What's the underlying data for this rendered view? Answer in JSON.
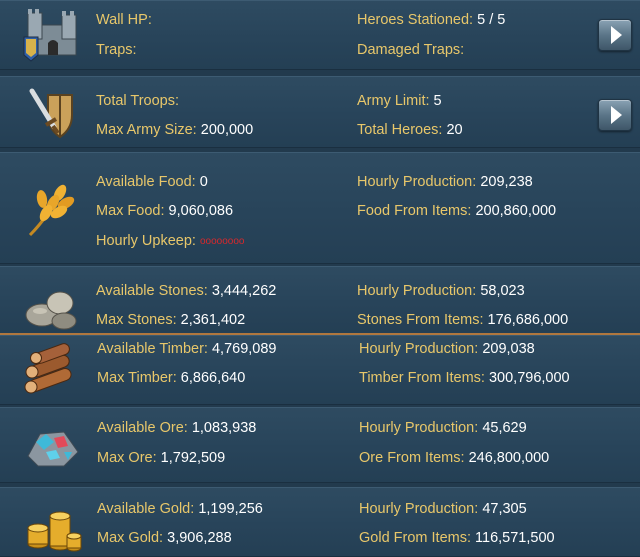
{
  "defense": {
    "wall_hp_label": "Wall HP:",
    "traps_label": "Traps:",
    "heroes_stationed_label": "Heroes Stationed:",
    "heroes_stationed_value": "5 / 5",
    "damaged_traps_label": "Damaged Traps:",
    "icon": "castle-icon"
  },
  "army": {
    "total_troops_label": "Total Troops:",
    "max_army_label": "Max Army Size:",
    "max_army_value": "200,000",
    "army_limit_label": "Army Limit:",
    "army_limit_value": "5",
    "total_heroes_label": "Total Heroes:",
    "total_heroes_value": "20",
    "icon": "sword-shield-icon"
  },
  "food": {
    "available_label": "Available Food:",
    "available_value": "0",
    "max_label": "Max Food:",
    "max_value": "9,060,086",
    "upkeep_label": "Hourly Upkeep:",
    "upkeep_value": "oooooooo",
    "hourly_label": "Hourly Production:",
    "hourly_value": "209,238",
    "items_label": "Food From Items:",
    "items_value": "200,860,000",
    "icon": "wheat-icon"
  },
  "stone": {
    "available_label": "Available Stones:",
    "available_value": "3,444,262",
    "max_label": "Max Stones:",
    "max_value": "2,361,402",
    "hourly_label": "Hourly Production:",
    "hourly_value": "58,023",
    "items_label": "Stones From Items:",
    "items_value": "176,686,000",
    "icon": "stone-icon"
  },
  "timber": {
    "available_label": "Available Timber:",
    "available_value": "4,769,089",
    "max_label": "Max Timber:",
    "max_value": "6,866,640",
    "hourly_label": "Hourly Production:",
    "hourly_value": "209,038",
    "items_label": "Timber From Items:",
    "items_value": "300,796,000",
    "icon": "timber-logs-icon"
  },
  "ore": {
    "available_label": "Available Ore:",
    "available_value": "1,083,938",
    "max_label": "Max Ore:",
    "max_value": "1,792,509",
    "hourly_label": "Hourly Production:",
    "hourly_value": "45,629",
    "items_label": "Ore From Items:",
    "items_value": "246,800,000",
    "icon": "ore-icon"
  },
  "gold": {
    "available_label": "Available Gold:",
    "available_value": "1,199,256",
    "max_label": "Max Gold:",
    "max_value": "3,906,288",
    "hourly_label": "Hourly Production:",
    "hourly_value": "47,305",
    "items_label": "Gold From Items:",
    "items_value": "116,571,500",
    "icon": "gold-coins-icon"
  },
  "colors": {
    "label": "#e8c76a",
    "value": "#ffffff",
    "upkeep": "#d8282c",
    "background": "#223a4d",
    "separator": "#b0773e"
  }
}
